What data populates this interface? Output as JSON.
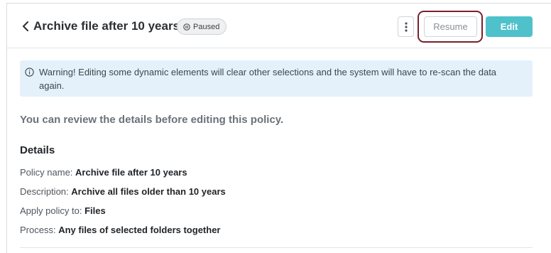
{
  "header": {
    "title": "Archive file after 10 years",
    "status_badge": "Paused",
    "resume_label": "Resume",
    "edit_label": "Edit"
  },
  "warning": {
    "text": "Warning! Editing some dynamic elements will clear other selections and the system will have to re-scan the data again."
  },
  "review_text": "You can review the details before editing this policy.",
  "details": {
    "heading": "Details",
    "rows": [
      {
        "label": "Policy name:",
        "value": "Archive file after 10 years"
      },
      {
        "label": "Description:",
        "value": "Archive all files older than 10 years"
      },
      {
        "label": "Apply policy to:",
        "value": "Files"
      },
      {
        "label": "Process:",
        "value": "Any files of selected folders together"
      }
    ]
  },
  "colors": {
    "accent": "#4ec1cb",
    "highlight": "#7a1f2e",
    "warning_bg": "#e4f1fb"
  },
  "icons": [
    "chevron-left-icon",
    "pause-icon",
    "more-vertical-icon",
    "info-icon"
  ]
}
